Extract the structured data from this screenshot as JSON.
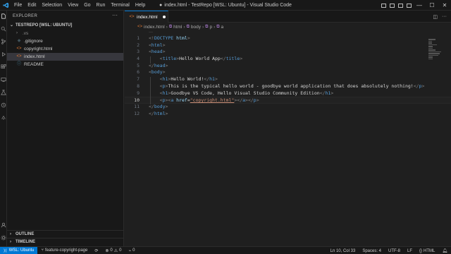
{
  "window": {
    "title": "index.html - TestRepo [WSL: Ubuntu] - Visual Studio Code",
    "dirty_marker": "●"
  },
  "menu": [
    "File",
    "Edit",
    "Selection",
    "View",
    "Go",
    "Run",
    "Terminal",
    "Help"
  ],
  "window_controls": {
    "minimize": "—",
    "maximize": "☐",
    "close": "✕"
  },
  "sidebar": {
    "title": "EXPLORER",
    "more": "···",
    "root": "TESTREPO [WSL: UBUNTU]",
    "items": [
      {
        "label": ".vs",
        "kind": "folder",
        "icon": "›"
      },
      {
        "label": ".gitignore",
        "kind": "gitignore",
        "icon": "◆"
      },
      {
        "label": "copyright.html",
        "kind": "html",
        "icon": "<>"
      },
      {
        "label": "index.html",
        "kind": "html",
        "icon": "<>"
      },
      {
        "label": "README",
        "kind": "info",
        "icon": "ⓘ"
      }
    ],
    "outline": "OUTLINE",
    "timeline": "TIMELINE"
  },
  "tabs": [
    {
      "label": "index.html",
      "icon": "<>"
    }
  ],
  "breadcrumbs": [
    "index.html",
    "html",
    "body",
    "p",
    "a"
  ],
  "code": {
    "current_line": 10,
    "ellipsis": "···",
    "lines": [
      {
        "n": "1",
        "parts": [
          [
            "br",
            "<!"
          ],
          [
            "tag",
            "DOCTYPE"
          ],
          [
            "text",
            " "
          ],
          [
            "attr",
            "html"
          ],
          [
            "br",
            ">"
          ]
        ]
      },
      {
        "n": "2",
        "parts": [
          [
            "br",
            "<"
          ],
          [
            "tag",
            "html"
          ],
          [
            "br",
            ">"
          ]
        ]
      },
      {
        "n": "3",
        "parts": [
          [
            "br",
            "<"
          ],
          [
            "tag",
            "head"
          ],
          [
            "br",
            ">"
          ]
        ]
      },
      {
        "n": "4",
        "parts": [
          [
            "text",
            "    "
          ],
          [
            "br",
            "<"
          ],
          [
            "tag",
            "title"
          ],
          [
            "br",
            ">"
          ],
          [
            "text",
            "Hello World App"
          ],
          [
            "br",
            "</"
          ],
          [
            "tag",
            "title"
          ],
          [
            "br",
            ">"
          ]
        ]
      },
      {
        "n": "5",
        "parts": [
          [
            "br",
            "</"
          ],
          [
            "tag",
            "head"
          ],
          [
            "br",
            ">"
          ]
        ]
      },
      {
        "n": "6",
        "parts": [
          [
            "br",
            "<"
          ],
          [
            "tag",
            "body"
          ],
          [
            "br",
            ">"
          ]
        ]
      },
      {
        "n": "7",
        "parts": [
          [
            "text",
            "    "
          ],
          [
            "br",
            "<"
          ],
          [
            "tag",
            "h1"
          ],
          [
            "br",
            ">"
          ],
          [
            "text",
            "Hello World!"
          ],
          [
            "br",
            "</"
          ],
          [
            "tag",
            "h1"
          ],
          [
            "br",
            ">"
          ]
        ]
      },
      {
        "n": "8",
        "parts": [
          [
            "text",
            "    "
          ],
          [
            "br",
            "<"
          ],
          [
            "tag",
            "p"
          ],
          [
            "br",
            ">"
          ],
          [
            "text",
            "This is the typical hello world - goodbye world application that does absolutely nothing!"
          ],
          [
            "br",
            "</"
          ],
          [
            "tag",
            "p"
          ],
          [
            "br",
            ">"
          ]
        ]
      },
      {
        "n": "9",
        "parts": [
          [
            "text",
            "    "
          ],
          [
            "br",
            "<"
          ],
          [
            "tag",
            "h1"
          ],
          [
            "br",
            ">"
          ],
          [
            "text",
            "Goodbye VS Code, Hello Visual Studio Community Edition"
          ],
          [
            "br",
            "</"
          ],
          [
            "tag",
            "h1"
          ],
          [
            "br",
            ">"
          ]
        ]
      },
      {
        "n": "10",
        "parts": [
          [
            "text",
            "    "
          ],
          [
            "br",
            "<"
          ],
          [
            "tag",
            "p"
          ],
          [
            "br",
            "><"
          ],
          [
            "tag",
            "a"
          ],
          [
            "text",
            " "
          ],
          [
            "attr",
            "href"
          ],
          [
            "text",
            "="
          ],
          [
            "str",
            "\"copyright.html\""
          ],
          [
            "br",
            ">"
          ],
          [
            "br",
            "</"
          ],
          [
            "tag",
            "a"
          ],
          [
            "br",
            "></"
          ],
          [
            "tag",
            "p"
          ],
          [
            "br",
            ">"
          ]
        ]
      },
      {
        "n": "11",
        "parts": [
          [
            "br",
            "</"
          ],
          [
            "tag",
            "body"
          ],
          [
            "br",
            ">"
          ]
        ]
      },
      {
        "n": "12",
        "parts": [
          [
            "br",
            "</"
          ],
          [
            "tag",
            "html"
          ],
          [
            "br",
            ">"
          ]
        ]
      }
    ]
  },
  "statusbar": {
    "remote": "WSL: Ubuntu",
    "branch": "feature-copyright-page",
    "errors": "0",
    "warnings": "0",
    "ports": "0",
    "cursor": "Ln 10, Col 33",
    "spaces": "Spaces: 4",
    "encoding": "UTF-8",
    "eol": "LF",
    "language": "HTML"
  },
  "colors": {
    "accent": "#0078d4",
    "tag": "#569cd6",
    "attr": "#9cdcfe",
    "string": "#ce9178",
    "html_icon": "#e37933"
  }
}
